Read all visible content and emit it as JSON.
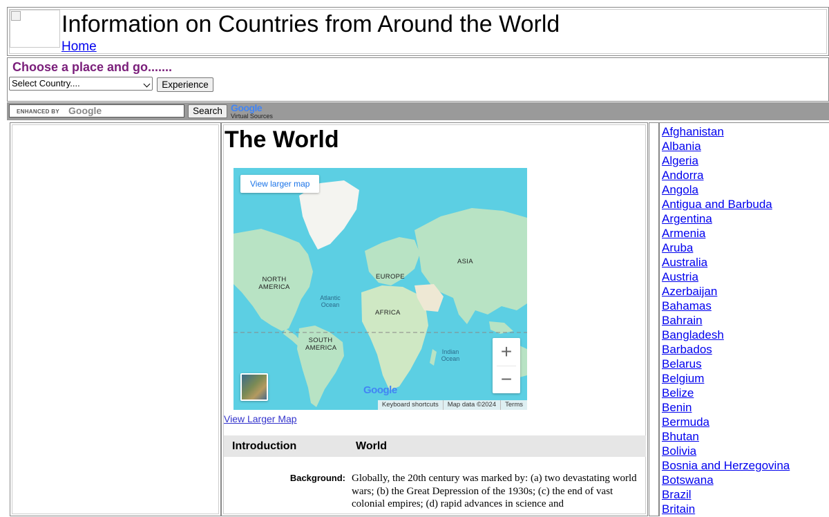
{
  "header": {
    "title": "Information on Countries from Around the World",
    "home_link": "Home"
  },
  "chooser": {
    "title": "Choose a place and go.......",
    "select_value": "Select Country....",
    "go_button": "Experience"
  },
  "search": {
    "input_watermark_prefix": "ENHANCED BY",
    "input_watermark_brand": "Google",
    "button": "Search",
    "brand": "Google",
    "brand_sub": "Virtual Sources"
  },
  "main": {
    "page_title": "The World",
    "map": {
      "view_larger_button": "View larger map",
      "zoom_in": "+",
      "zoom_out": "−",
      "google_logo": "Google",
      "footer": [
        "Keyboard shortcuts",
        "Map data ©2024",
        "Terms"
      ],
      "labels": {
        "north_america": "NORTH AMERICA",
        "south_america": "SOUTH AMERICA",
        "europe": "EUROPE",
        "asia": "ASIA",
        "africa": "AFRICA",
        "atlantic": "Atlantic Ocean",
        "indian": "Indian Ocean"
      }
    },
    "view_larger_link": "View Larger Map",
    "intro": {
      "label": "Introduction",
      "value": "World"
    },
    "background": {
      "label": "Background:",
      "text": "Globally, the 20th century was marked by: (a) two devastating world wars; (b) the Great Depression of the 1930s; (c) the end of vast colonial empires; (d) rapid advances in science and"
    }
  },
  "countries": [
    "Afghanistan",
    "Albania",
    "Algeria",
    "Andorra",
    "Angola",
    "Antigua and Barbuda",
    "Argentina",
    "Armenia",
    "Aruba",
    "Australia",
    "Austria",
    "Azerbaijan",
    "Bahamas",
    "Bahrain",
    "Bangladesh",
    "Barbados",
    "Belarus",
    "Belgium",
    "Belize",
    "Benin",
    "Bermuda",
    "Bhutan",
    "Bolivia",
    "Bosnia and Herzegovina",
    "Botswana",
    "Brazil",
    "Britain"
  ],
  "colors": {
    "link": "#0000ee",
    "chooser_title": "#7a1e7a",
    "search_bar": "#9a9a9a",
    "ocean": "#5ccfe3",
    "land": "#b8e3c4",
    "intro_bar": "#e6e6e6"
  }
}
